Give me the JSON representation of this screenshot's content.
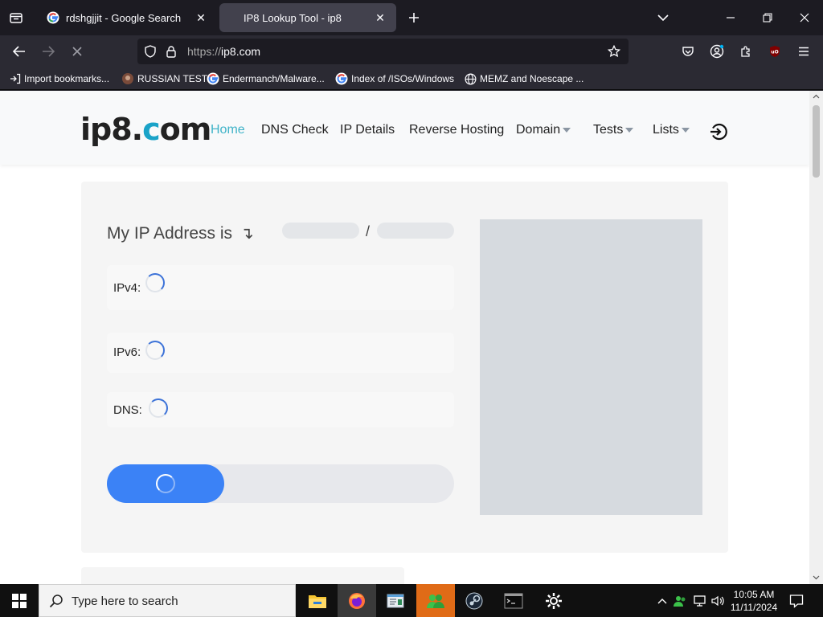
{
  "browser": {
    "tabs": [
      {
        "title": "rdshgjjit - Google Search",
        "favicon": "google-icon",
        "active": false
      },
      {
        "title": "IP8 Lookup Tool - ip8",
        "favicon": "none",
        "active": true
      }
    ],
    "url": {
      "scheme": "https://",
      "host": "ip8.com"
    },
    "bookmarks": [
      {
        "label": "Import bookmarks...",
        "icon": "import-icon"
      },
      {
        "label": "RUSSIAN TEST",
        "icon": "page-icon"
      },
      {
        "label": "Endermanch/Malware...",
        "icon": "google-icon"
      },
      {
        "label": "Index of /ISOs/Windows",
        "icon": "google-icon"
      },
      {
        "label": "MEMZ and Noescape ...",
        "icon": "globe-icon"
      }
    ]
  },
  "site": {
    "logo": {
      "part1": "ip8.",
      "part2": "c",
      "part3": "o",
      "part4": "m"
    },
    "nav": [
      {
        "label": "Home",
        "active": true
      },
      {
        "label": "DNS Check"
      },
      {
        "label": "IP Details"
      },
      {
        "label": "Reverse Hosting"
      },
      {
        "label": "Domain",
        "dropdown": true
      },
      {
        "label": "Tests",
        "dropdown": true
      },
      {
        "label": "Lists",
        "dropdown": true
      }
    ],
    "ip_card": {
      "title": "My IP Address is",
      "arrow": "↴",
      "separator": "/",
      "rows": [
        {
          "label": "IPv4:"
        },
        {
          "label": "IPv6:"
        },
        {
          "label": "DNS:"
        }
      ]
    },
    "accent_color": "#3fb3c8",
    "button_color": "#3b82f6"
  },
  "taskbar": {
    "search_placeholder": "Type here to search",
    "apps": [
      "file-explorer-icon",
      "firefox-icon",
      "notepad-icon",
      "people-icon",
      "steam-icon",
      "terminal-icon",
      "settings-icon"
    ],
    "time": "10:05 AM",
    "date": "11/11/2024"
  }
}
